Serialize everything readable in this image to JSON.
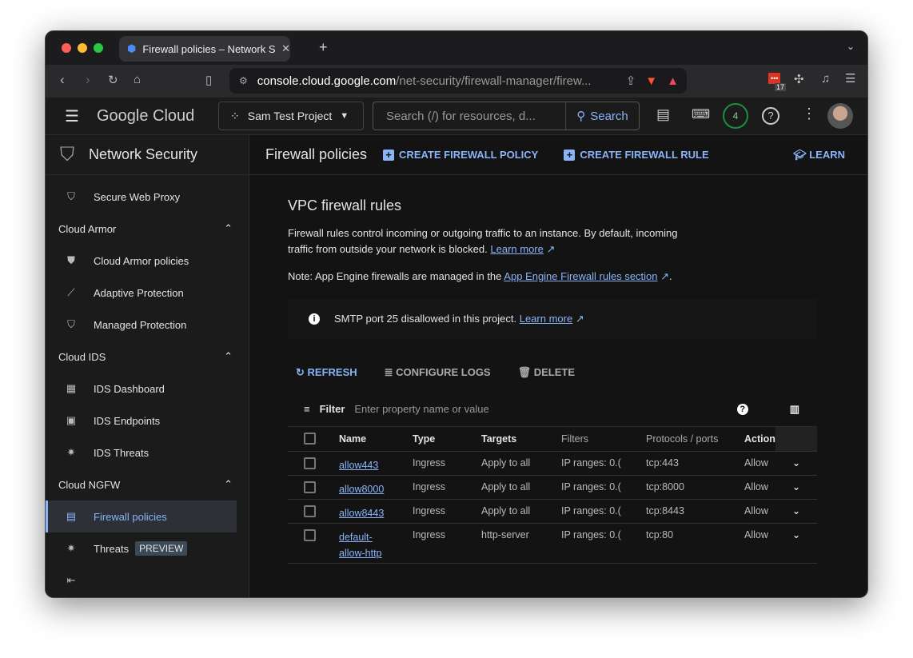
{
  "browser": {
    "tab_title": "Firewall policies – Network Se",
    "url_host": "console.cloud.google.com",
    "url_path": "/net-security/firewall-manager/firew...",
    "ext_badge": "17"
  },
  "header": {
    "logo": "Google Cloud",
    "project": "Sam Test Project",
    "search_placeholder": "Search (/) for resources, d...",
    "search_button": "Search",
    "notifications": "4"
  },
  "sidebar": {
    "title": "Network Security",
    "items": [
      {
        "label": "Secure Web Proxy",
        "icon": "proxy-icon"
      },
      {
        "section": "Cloud Armor"
      },
      {
        "label": "Cloud Armor policies",
        "icon": "shield-icon"
      },
      {
        "label": "Adaptive Protection",
        "icon": "chart-icon"
      },
      {
        "label": "Managed Protection",
        "icon": "shield-icon"
      },
      {
        "section": "Cloud IDS"
      },
      {
        "label": "IDS Dashboard",
        "icon": "dashboard-icon"
      },
      {
        "label": "IDS Endpoints",
        "icon": "endpoint-icon"
      },
      {
        "label": "IDS Threats",
        "icon": "threat-icon"
      },
      {
        "section": "Cloud NGFW"
      },
      {
        "label": "Firewall policies",
        "icon": "firewall-icon",
        "active": true
      },
      {
        "label": "Threats",
        "icon": "threat-icon",
        "badge": "PREVIEW"
      }
    ]
  },
  "titlebar": {
    "title": "Firewall policies",
    "create_policy": "CREATE FIREWALL POLICY",
    "create_rule": "CREATE FIREWALL RULE",
    "learn": "LEARN"
  },
  "main": {
    "heading": "VPC firewall rules",
    "desc": "Firewall rules control incoming or outgoing traffic to an instance. By default, incoming traffic from outside your network is blocked.",
    "learn_more": "Learn more",
    "note": "Note: App Engine firewalls are managed in the",
    "note_link": "App Engine Firewall rules section",
    "info": "SMTP port 25 disallowed in this project.",
    "info_link": "Learn more",
    "actions": {
      "refresh": "REFRESH",
      "configure_logs": "CONFIGURE LOGS",
      "delete": "DELETE"
    },
    "filter_label": "Filter",
    "filter_placeholder": "Enter property name or value",
    "columns": [
      "Name",
      "Type",
      "Targets",
      "Filters",
      "Protocols / ports",
      "Action"
    ],
    "rows": [
      [
        "allow443",
        "Ingress",
        "Apply to all",
        "IP ranges: 0.(",
        "tcp:443",
        "Allow"
      ],
      [
        "allow8000",
        "Ingress",
        "Apply to all",
        "IP ranges: 0.(",
        "tcp:8000",
        "Allow"
      ],
      [
        "allow8443",
        "Ingress",
        "Apply to all",
        "IP ranges: 0.(",
        "tcp:8443",
        "Allow"
      ],
      [
        "default-allow-http",
        "Ingress",
        "http-server",
        "IP ranges: 0.(",
        "tcp:80",
        "Allow"
      ]
    ]
  }
}
